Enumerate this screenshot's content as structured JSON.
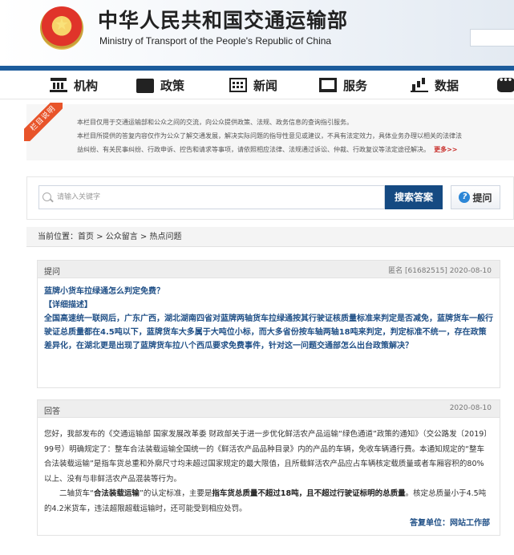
{
  "header": {
    "title_cn": "中华人民共和国交通运输部",
    "title_en": "Ministry of Transport of the People's Republic of China"
  },
  "nav": [
    {
      "label": "机构",
      "icon": "institution-icon"
    },
    {
      "label": "政策",
      "icon": "folder-icon"
    },
    {
      "label": "新闻",
      "icon": "calendar-icon"
    },
    {
      "label": "服务",
      "icon": "monitor-icon"
    },
    {
      "label": "数据",
      "icon": "bar-chart-icon"
    },
    {
      "label": "",
      "icon": "chat-icon"
    }
  ],
  "notice": {
    "ribbon": "栏目说明",
    "line1": "本栏目仅用于交通运输部和公众之间的交流，向公众提供政策、法规、政务信息的查询指引服务。",
    "line2": "本栏目所提供的答复内容仅作为公众了解交通发展，解决实际问题的指导性意见或建议，不具有法定效力，具体业务办理以相关的法律法",
    "line3": "益纠纷、有关民事纠纷、行政申诉、控告和请求等事项，请依照相应法律、法规通过诉讼、仲裁、行政复议等法定途径解决。",
    "more": "更多>>"
  },
  "search": {
    "placeholder": "请输入关键字",
    "search_button": "搜索答案",
    "ask_button": "提问"
  },
  "breadcrumb": "当前位置：首页 > 公众留言 > 热点问题",
  "question": {
    "label": "提问",
    "meta": "匿名  [61682515]  2020-08-10",
    "title": "蓝牌小货车拉绿通怎么判定免费？",
    "detail_label": "【详细描述】",
    "detail": "全国高速统一联网后，广东广西，湖北湖南四省对蓝牌两轴货车拉绿通按其行驶证核质量标准来判定是否减免，蓝牌货车一般行驶证总质量都在4.5吨以下，蓝牌货车大多属于大吨位小标，而大多省份按车轴两轴18吨来判定，判定标准不统一，存在政策差异化，在湖北更是出现了蓝牌货车拉八个西瓜要求免费事件，针对这一问题交通部怎么出台政策解决？"
  },
  "answer": {
    "label": "回答",
    "date": "2020-08-10",
    "para1": "您好，我部发布的《交通运输部 国家发展改革委 财政部关于进一步优化鲜活农产品运输“绿色通道”政策的通知》（交公路发〔2019〕99号）明确规定了：整车合法装载运输全国统一的《鲜活农产品品种目录》内的产品的车辆，免收车辆通行费。本通知规定的“整车合法装载运输”是指车货总重和外廓尺寸均未超过国家规定的最大限值，且所载鲜活农产品应占车辆核定载质量或者车厢容积的80%以上、没有与非鲜活农产品混装等行为。",
    "para2_a": "二轴货车“",
    "para2_b": "合法装载运输",
    "para2_c": "”的认定标准，主要是",
    "para2_d": "指车货总质量不超过18吨，且不超过行驶证标明的总质量",
    "para2_e": "。核定总质量小于4.5吨的4.2米货车，违法超限超载运输时，还可能受到相应处罚。",
    "signature": "答复单位：网站工作部"
  },
  "colors": {
    "brand_blue": "#154a82",
    "header_strip": "#1c5c9c",
    "question_text": "#1f4f86",
    "ribbon": "#e8542a"
  }
}
